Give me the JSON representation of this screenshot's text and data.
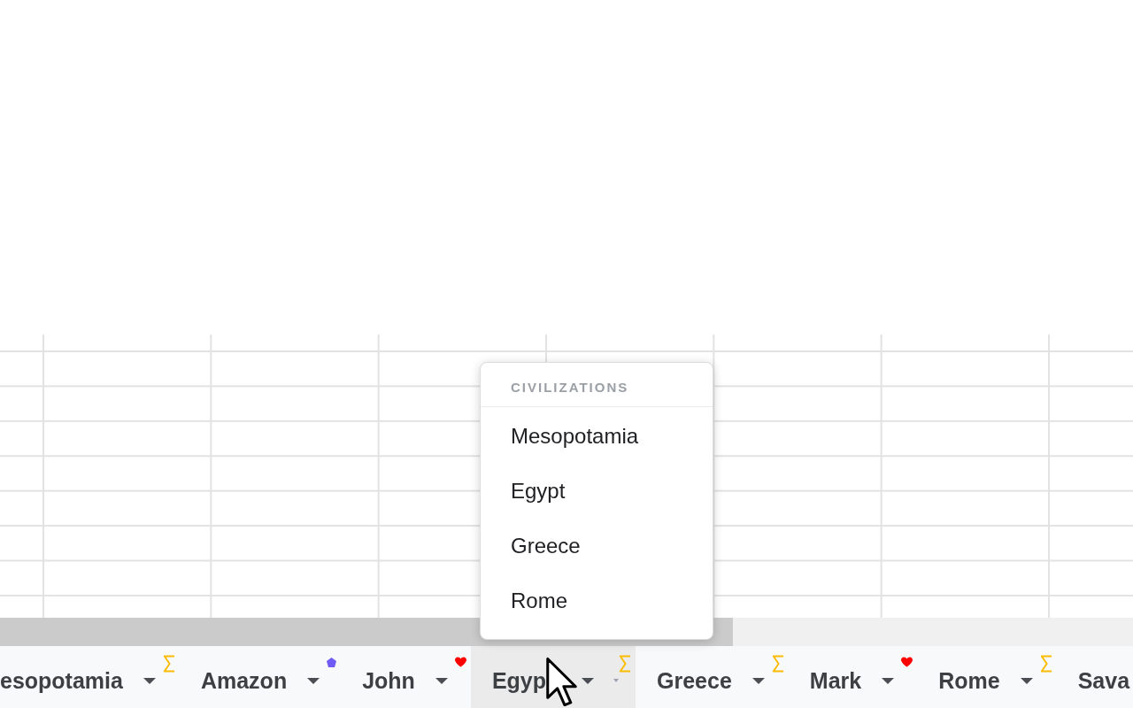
{
  "menu": {
    "header": "CIVILIZATIONS",
    "items": [
      {
        "label": "Mesopotamia"
      },
      {
        "label": "Egypt"
      },
      {
        "label": "Greece"
      },
      {
        "label": "Rome"
      }
    ]
  },
  "sheet_tabs": [
    {
      "label": "esopotamia",
      "selected": false,
      "hovered": false,
      "dropdown": true,
      "badge": {
        "kind": "sigma"
      }
    },
    {
      "label": "Amazon",
      "selected": false,
      "hovered": false,
      "dropdown": true,
      "badge": {
        "kind": "pentagon"
      }
    },
    {
      "label": "John",
      "selected": false,
      "hovered": false,
      "dropdown": true,
      "badge": {
        "kind": "heart"
      }
    },
    {
      "label": "Egyp",
      "selected": true,
      "hovered": true,
      "dropdown": true,
      "badge": {
        "kind": "sigma"
      }
    },
    {
      "label": "Greece",
      "selected": false,
      "hovered": false,
      "dropdown": true,
      "badge": {
        "kind": "sigma"
      }
    },
    {
      "label": "Mark",
      "selected": false,
      "hovered": false,
      "dropdown": true,
      "badge": {
        "kind": "heart"
      }
    },
    {
      "label": "Rome",
      "selected": false,
      "hovered": false,
      "dropdown": true,
      "badge": {
        "kind": "sigma"
      }
    },
    {
      "label": "Sava",
      "selected": false,
      "hovered": false,
      "dropdown": false
    }
  ]
}
